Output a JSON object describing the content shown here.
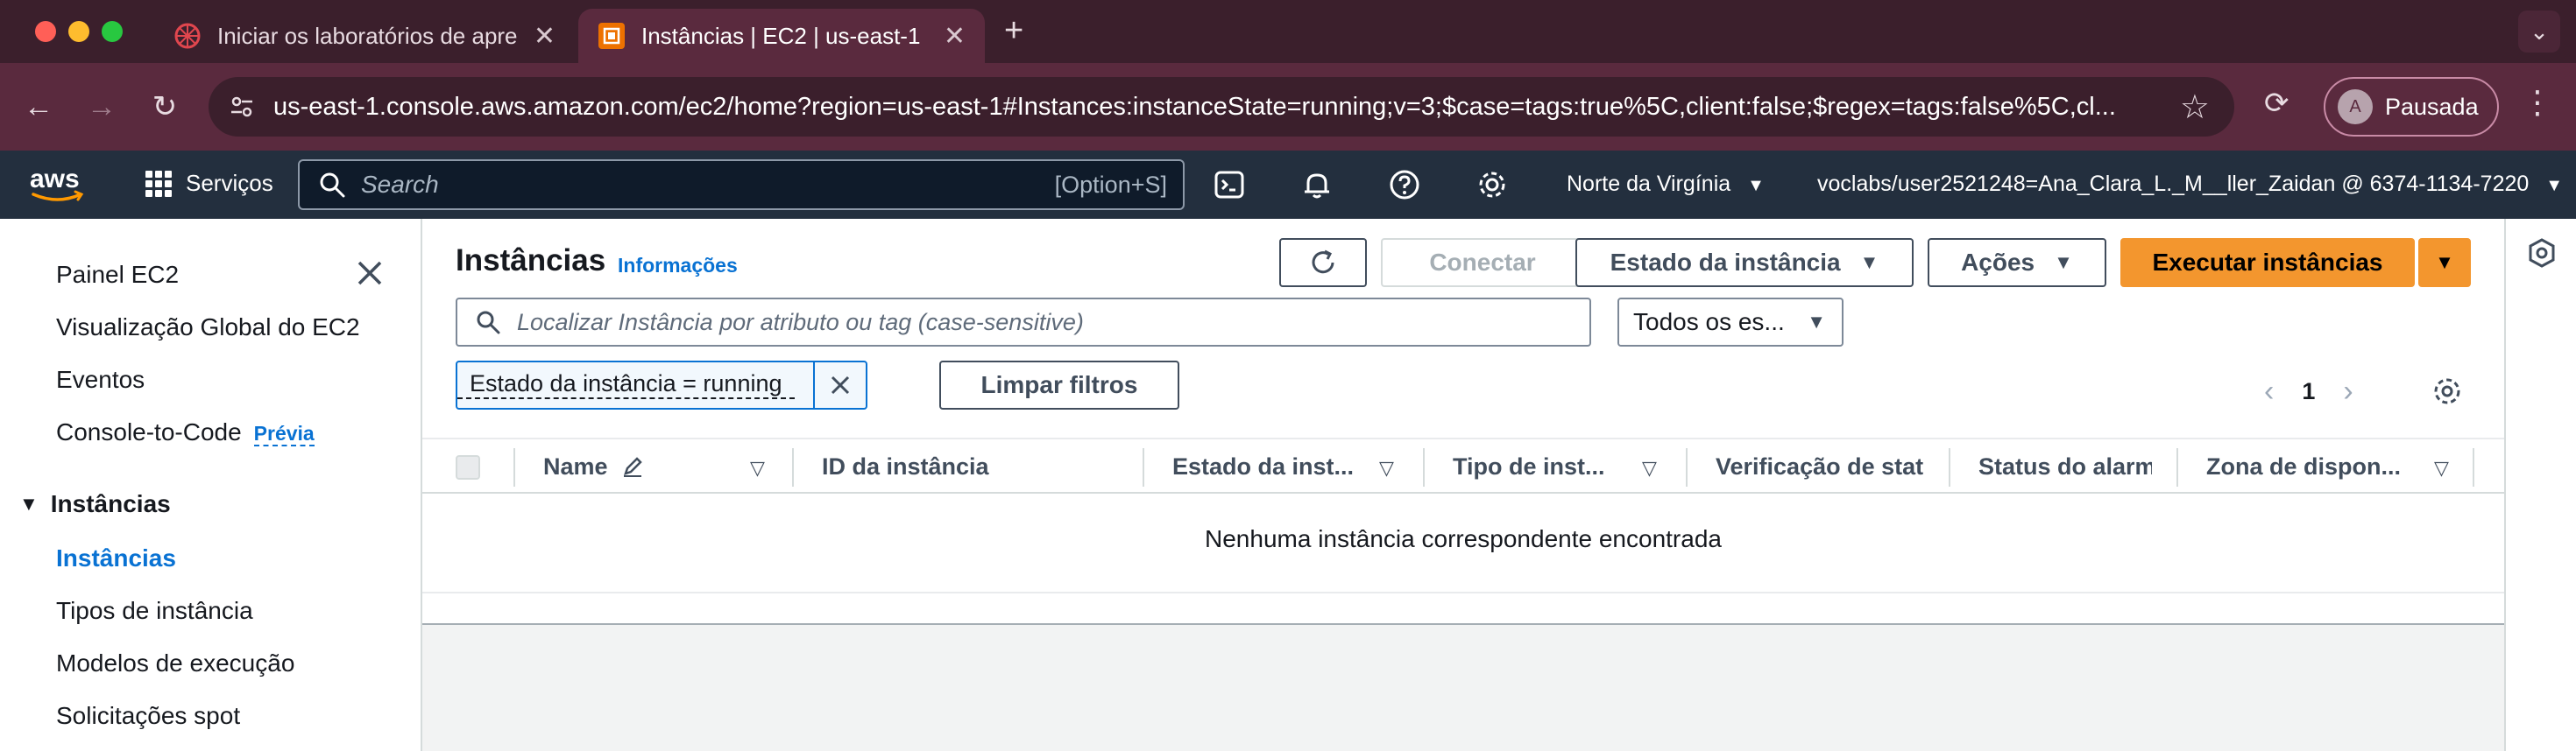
{
  "browser": {
    "tabs": [
      {
        "title": "Iniciar os laboratórios de apre",
        "active": false
      },
      {
        "title": "Instâncias | EC2 | us-east-1",
        "active": true
      }
    ],
    "url": "us-east-1.console.aws.amazon.com/ec2/home?region=us-east-1#Instances:instanceState=running;v=3;$case=tags:true%5C,client:false;$regex=tags:false%5C,cl...",
    "profile": {
      "initial": "A",
      "label": "Pausada"
    }
  },
  "aws_nav": {
    "services_label": "Serviços",
    "search_placeholder": "Search",
    "search_shortcut": "[Option+S]",
    "region": "Norte da Virgínia",
    "account": "voclabs/user2521248=Ana_Clara_L._M__ller_Zaidan @ 6374-1134-7220"
  },
  "sidebar": {
    "items": [
      {
        "label": "Painel EC2"
      },
      {
        "label": "Visualização Global do EC2"
      },
      {
        "label": "Eventos"
      },
      {
        "label": "Console-to-Code",
        "badge": "Prévia"
      }
    ],
    "section": {
      "label": "Instâncias",
      "items": [
        {
          "label": "Instâncias",
          "active": true
        },
        {
          "label": "Tipos de instância"
        },
        {
          "label": "Modelos de execução"
        },
        {
          "label": "Solicitações spot"
        }
      ]
    }
  },
  "main": {
    "title": "Instâncias",
    "info_link": "Informações",
    "buttons": {
      "connect": "Conectar",
      "instance_state": "Estado da instância",
      "actions": "Ações",
      "launch": "Executar instâncias",
      "clear_filters": "Limpar filtros"
    },
    "search_placeholder": "Localizar Instância por atributo ou tag (case-sensitive)",
    "state_select": "Todos os es...",
    "filter_token": "Estado da instância = running",
    "pagination": {
      "current_page": "1"
    },
    "table": {
      "columns": [
        "Name",
        "ID da instância",
        "Estado da inst...",
        "Tipo de inst...",
        "Verificação de stat",
        "Status do alarm",
        "Zona de dispon..."
      ],
      "empty_message": "Nenhuma instância correspondente encontrada"
    }
  },
  "colors": {
    "aws_nav_bg": "#232f3e",
    "primary_button": "#f3962e",
    "link": "#0972d3",
    "browser_frame": "#5a2a3e"
  }
}
